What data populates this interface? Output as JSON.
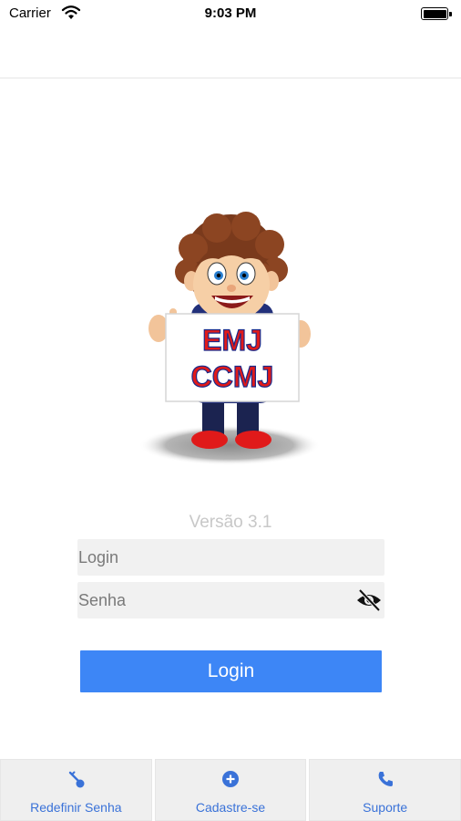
{
  "status_bar": {
    "carrier": "Carrier",
    "time": "9:03 PM"
  },
  "mascot": {
    "sign_line1": "EMJ",
    "sign_line2": "CCMJ"
  },
  "version": "Versão 3.1",
  "form": {
    "login_placeholder": "Login",
    "login_value": "",
    "password_placeholder": "Senha",
    "password_value": "",
    "submit_label": "Login"
  },
  "tab_bar": {
    "reset_password": {
      "label": "Redefinir Senha",
      "icon": "key-icon"
    },
    "register": {
      "label": "Cadastre-se",
      "icon": "plus-circle-icon"
    },
    "support": {
      "label": "Suporte",
      "icon": "phone-icon"
    }
  },
  "colors": {
    "accent": "#3d86f6",
    "tab_label": "#3a72d8",
    "field_bg": "#f1f1f1",
    "version_text": "#c8c8c8"
  }
}
